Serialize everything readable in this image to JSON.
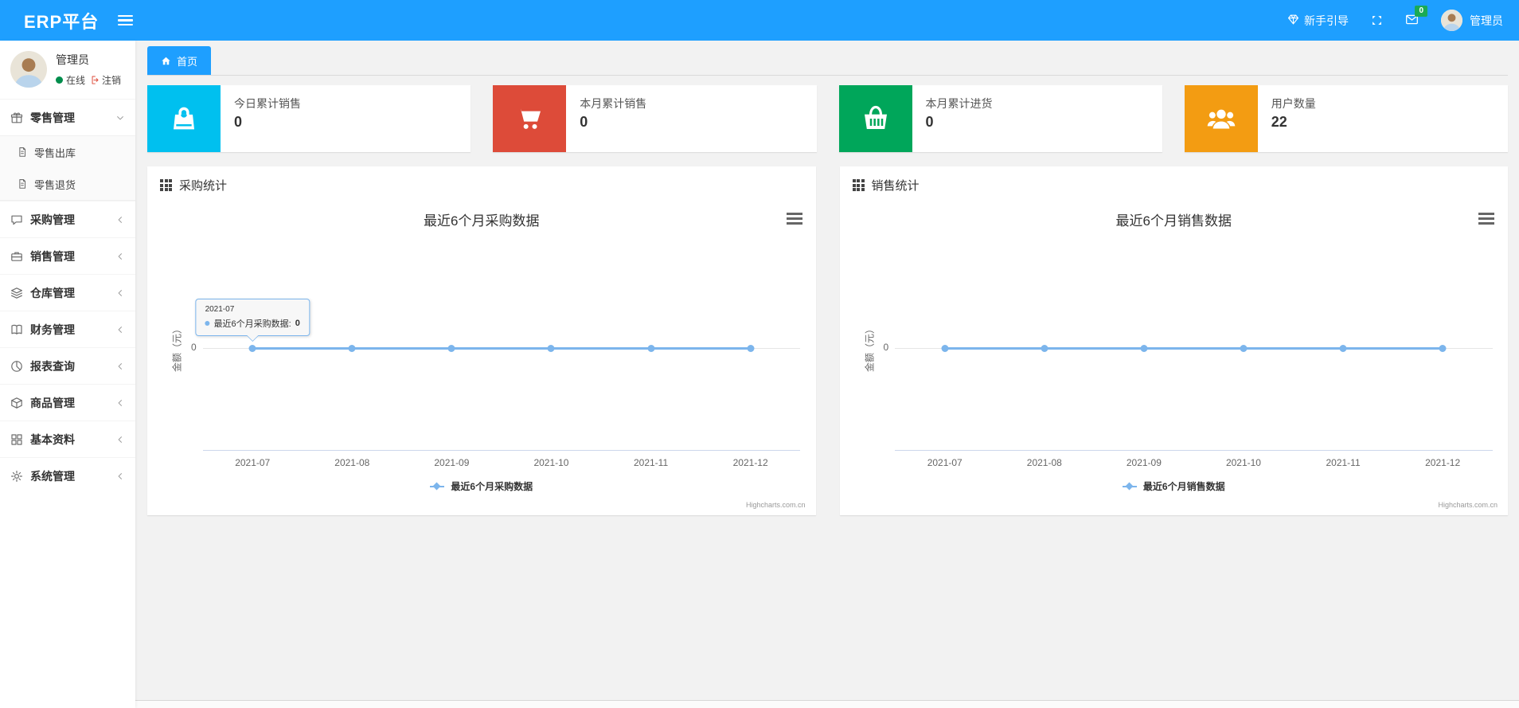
{
  "navbar": {
    "brand": "ERP平台",
    "guide_label": "新手引导",
    "message_badge": "0",
    "user_name": "管理员"
  },
  "sidebar": {
    "user": {
      "name": "管理员",
      "status_label": "在线",
      "logout_label": "注销"
    },
    "items": [
      {
        "id": "retail",
        "label": "零售管理",
        "icon": "gift-icon",
        "state": "expanded",
        "children": [
          {
            "id": "retail-out",
            "label": "零售出库",
            "icon": "file-icon"
          },
          {
            "id": "retail-return",
            "label": "零售退货",
            "icon": "file-icon"
          }
        ]
      },
      {
        "id": "purchase",
        "label": "采购管理",
        "icon": "chat-icon",
        "state": "collapsed"
      },
      {
        "id": "sales",
        "label": "销售管理",
        "icon": "briefcase-icon",
        "state": "collapsed"
      },
      {
        "id": "warehouse",
        "label": "仓库管理",
        "icon": "layers-icon",
        "state": "collapsed"
      },
      {
        "id": "finance",
        "label": "财务管理",
        "icon": "book-icon",
        "state": "collapsed"
      },
      {
        "id": "reports",
        "label": "报表查询",
        "icon": "pie-chart-icon",
        "state": "collapsed"
      },
      {
        "id": "goods",
        "label": "商品管理",
        "icon": "box-icon",
        "state": "collapsed"
      },
      {
        "id": "basic",
        "label": "基本资料",
        "icon": "grid-icon",
        "state": "collapsed"
      },
      {
        "id": "system",
        "label": "系统管理",
        "icon": "gear-icon",
        "state": "collapsed"
      }
    ]
  },
  "tab_bar": {
    "active_tab": "首页"
  },
  "stat_cards": [
    {
      "label": "今日累计销售",
      "value": "0",
      "color": "#00c0ef",
      "icon": "shopping-bag-icon"
    },
    {
      "label": "本月累计销售",
      "value": "0",
      "color": "#dd4b39",
      "icon": "shopping-cart-icon"
    },
    {
      "label": "本月累计进货",
      "value": "0",
      "color": "#00a65a",
      "icon": "shopping-basket-icon"
    },
    {
      "label": "用户数量",
      "value": "22",
      "color": "#f39c12",
      "icon": "users-icon"
    }
  ],
  "chart_data": [
    {
      "type": "line",
      "panel_title": "采购统计",
      "title": "最近6个月采购数据",
      "x": [
        "2021-07",
        "2021-08",
        "2021-09",
        "2021-10",
        "2021-11",
        "2021-12"
      ],
      "series": [
        {
          "name": "最近6个月采购数据",
          "values": [
            0,
            0,
            0,
            0,
            0,
            0
          ]
        }
      ],
      "ylabel": "金额（元）",
      "yticks": [
        "0"
      ],
      "ylim": [
        0,
        1
      ],
      "grid": true,
      "legend_position": "bottom",
      "line_color": "#7cb5ec",
      "credit": "Highcharts.com.cn",
      "tooltip": {
        "header": "2021-07",
        "series": "最近6个月采购数据:",
        "value": "0"
      }
    },
    {
      "type": "line",
      "panel_title": "销售统计",
      "title": "最近6个月销售数据",
      "x": [
        "2021-07",
        "2021-08",
        "2021-09",
        "2021-10",
        "2021-11",
        "2021-12"
      ],
      "series": [
        {
          "name": "最近6个月销售数据",
          "values": [
            0,
            0,
            0,
            0,
            0,
            0
          ]
        }
      ],
      "ylabel": "金额（元）",
      "yticks": [
        "0"
      ],
      "ylim": [
        0,
        1
      ],
      "grid": true,
      "legend_position": "bottom",
      "line_color": "#7cb5ec",
      "credit": "Highcharts.com.cn",
      "tooltip": null
    }
  ],
  "colors": {
    "accent": "#1E9FFF",
    "badge_green": "#1aaa55",
    "online_green": "#008d4c",
    "logout_red": "#dd4b39",
    "chart_line": "#7cb5ec"
  }
}
